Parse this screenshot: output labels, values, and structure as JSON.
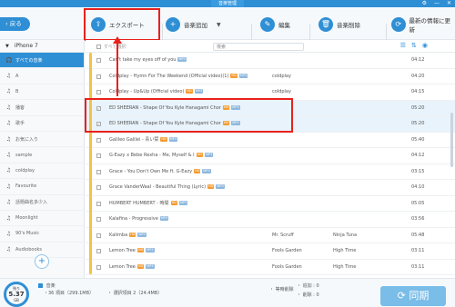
{
  "window": {
    "title": "音楽管理"
  },
  "toolbar": {
    "back_label": "戻る",
    "export_label": "エクスポート",
    "add_label": "音楽追加",
    "edit_label": "編集",
    "delete_label": "音楽削除",
    "update_label": "最新の情報に更新"
  },
  "sidebar": {
    "device_name": "iPhone 7",
    "items": [
      {
        "label": "すべての音楽",
        "active": true
      },
      {
        "label": "A"
      },
      {
        "label": "B"
      },
      {
        "label": "播客"
      },
      {
        "label": "歌手"
      },
      {
        "label": "お気に入り"
      },
      {
        "label": "sample"
      },
      {
        "label": "coldplay"
      },
      {
        "label": "Favourite"
      },
      {
        "label": "話題曲名多少入"
      },
      {
        "label": "Moonlight"
      },
      {
        "label": "90's Music"
      },
      {
        "label": "Audiobooks"
      }
    ]
  },
  "table": {
    "select_all_label": "すべて選択",
    "search_placeholder": "検索",
    "rows": [
      {
        "title": "Can't take my eyes off of you",
        "tags": [
          "MP3"
        ],
        "artist": "",
        "album": "",
        "time": "04:12",
        "checked": false,
        "selected": false
      },
      {
        "title": "Coldplay - Hymn For The Weekend (Official video)(1)",
        "tags": [
          "HD",
          "MP3"
        ],
        "artist": "coldplay",
        "album": "",
        "time": "04:20",
        "checked": false,
        "selected": false
      },
      {
        "title": "Coldplay - Up&Up (Official video)",
        "tags": [
          "HD",
          "MP3"
        ],
        "artist": "coldplay",
        "album": "",
        "time": "04:15",
        "checked": false,
        "selected": false
      },
      {
        "title": "ED SHEERAN - Shape Of You   Kyle Hanagami Chor",
        "tags": [
          "HD",
          "MP3"
        ],
        "artist": "",
        "album": "",
        "time": "05:20",
        "checked": true,
        "selected": true
      },
      {
        "title": "ED SHEERAN - Shape Of You   Kyle Hanagami Chor",
        "tags": [
          "HD",
          "MP3"
        ],
        "artist": "",
        "album": "",
        "time": "05:20",
        "checked": true,
        "selected": true
      },
      {
        "title": "Galileo Galilei - 青い栞",
        "tags": [
          "HD",
          "MP3"
        ],
        "artist": "",
        "album": "",
        "time": "05:40",
        "checked": false,
        "selected": false
      },
      {
        "title": "G-Eazy x Bebe Rexha - Me, Myself & I",
        "tags": [
          "HD",
          "MP3"
        ],
        "artist": "",
        "album": "",
        "time": "04:12",
        "checked": false,
        "selected": false
      },
      {
        "title": "Grace - You Don't Own Me ft. G-Eazy",
        "tags": [
          "HD",
          "MP3"
        ],
        "artist": "",
        "album": "",
        "time": "03:15",
        "checked": false,
        "selected": false
      },
      {
        "title": "Grace VanderWaal - Beautiful Thing (Lyric)",
        "tags": [
          "HD",
          "MP3"
        ],
        "artist": "",
        "album": "",
        "time": "04:10",
        "checked": false,
        "selected": false
      },
      {
        "title": "HUMBERT HUMBERT - 時間",
        "tags": [
          "HD",
          "MP3"
        ],
        "artist": "",
        "album": "",
        "time": "05:05",
        "checked": false,
        "selected": false
      },
      {
        "title": "Kalafina - Progressive",
        "tags": [
          "MP3"
        ],
        "artist": "",
        "album": "",
        "time": "03:56",
        "checked": false,
        "selected": false
      },
      {
        "title": "Kalimba",
        "tags": [
          "HD",
          "MP3"
        ],
        "artist": "Mr. Scruff",
        "album": "Ninja Tuna",
        "time": "05:48",
        "checked": false,
        "selected": false
      },
      {
        "title": "Lemon Tree",
        "tags": [
          "HD",
          "MP3"
        ],
        "artist": "Fools Garden",
        "album": "High Time",
        "time": "03:11",
        "checked": false,
        "selected": false
      },
      {
        "title": "Lemon Tree",
        "tags": [
          "HD",
          "MP3"
        ],
        "artist": "Fools Garden",
        "album": "High Time",
        "time": "03:11",
        "checked": false,
        "selected": false
      }
    ]
  },
  "bottom": {
    "storage_label": "残り",
    "storage_value": "5.37",
    "storage_unit": "GB",
    "music_label": "音楽",
    "music_count": "・36 項目（299.1MB）",
    "selected_count": "・ 選択項目 2（24.4MB）",
    "pending_delete": "・ 等時削除",
    "add_count": "・ 追加 : 0",
    "delete_count": "・ 削除 : 0",
    "sync_label": "同期"
  },
  "colors": {
    "accent": "#2f8fd5",
    "highlight": "#e8211d",
    "tag_hd": "#f39c32",
    "tag_mp3": "#8fb8de"
  }
}
